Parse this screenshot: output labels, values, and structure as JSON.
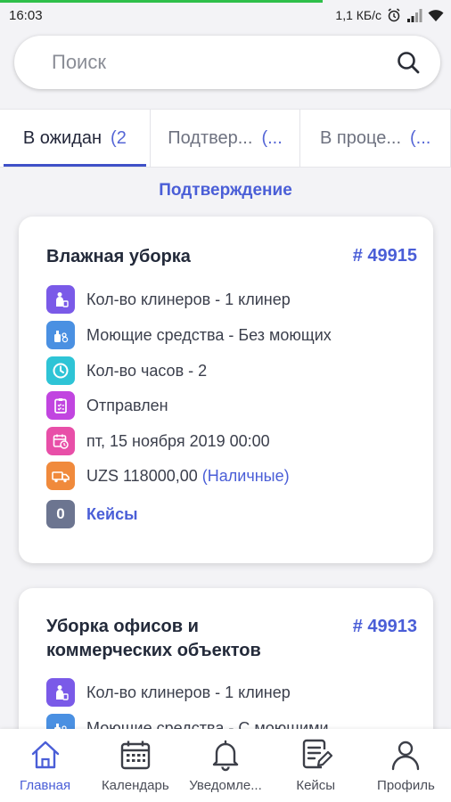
{
  "status": {
    "time": "16:03",
    "speed": "1,1 КБ/с"
  },
  "search": {
    "placeholder": "Поиск"
  },
  "tabs": [
    {
      "label": "В ожидан",
      "count": "(2"
    },
    {
      "label": "Подтвер...",
      "count": "(..."
    },
    {
      "label": "В проце...",
      "count": "(..."
    }
  ],
  "section_title": "Подтверждение",
  "orders": [
    {
      "title_lines": [
        "Влажная уборка"
      ],
      "number": "# 49915",
      "cleaners": "Кол-во клинеров - 1 клинер",
      "detergents": "Моющие средства - Без моющих",
      "hours": "Кол-во часов - 2",
      "status": "Отправлен",
      "date": "пт, 15 ноября 2019 00:00",
      "price": "UZS 118000,00",
      "payment": "(Наличные)",
      "cases_count": "0",
      "cases_label": "Кейсы"
    },
    {
      "title_lines": [
        "Уборка офисов и",
        "коммерческих объектов"
      ],
      "number": "# 49913",
      "cleaners": "Кол-во клинеров - 1 клинер",
      "detergents": "Моющие средства - С моющими"
    }
  ],
  "nav": [
    {
      "label": "Главная",
      "icon": "home-icon",
      "active": true
    },
    {
      "label": "Календарь",
      "icon": "calendar-icon"
    },
    {
      "label": "Уведомле...",
      "icon": "bell-icon"
    },
    {
      "label": "Кейсы",
      "icon": "cases-icon"
    },
    {
      "label": "Профиль",
      "icon": "profile-icon"
    }
  ],
  "colors": {
    "accent": "#4a5ed7",
    "cleaners_icon": "#7a5ae8",
    "detergents_icon": "#4a90e2",
    "hours_icon": "#2ec4d6",
    "status_icon": "#c145e0",
    "date_icon": "#e84fa8",
    "price_icon": "#f08a3c",
    "badge": "#6c7590"
  }
}
